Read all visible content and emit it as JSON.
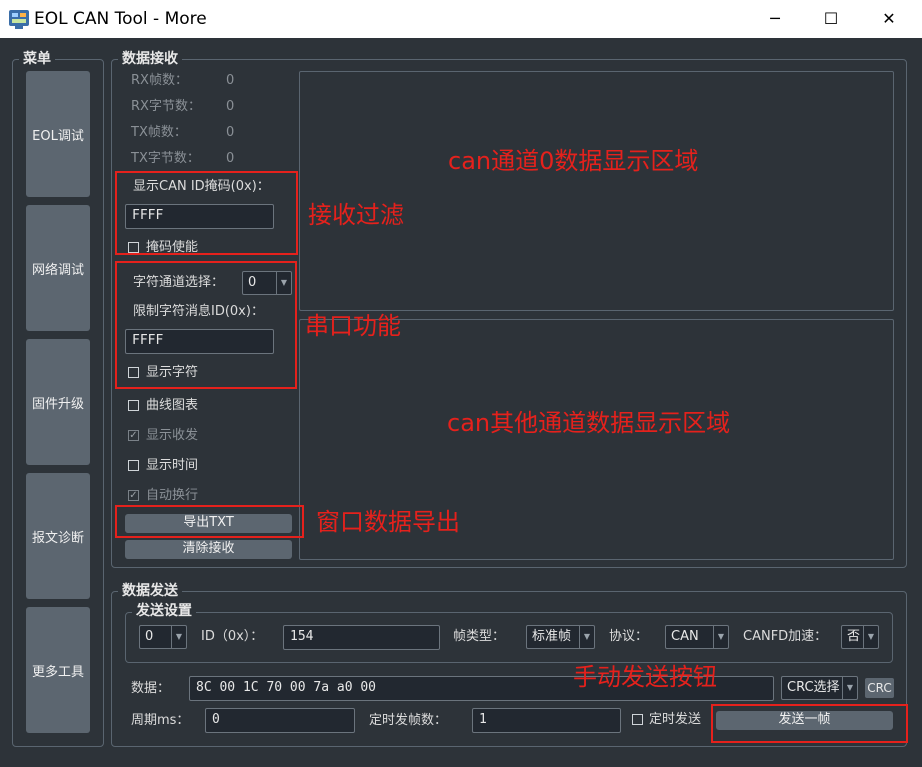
{
  "window": {
    "title": "EOL CAN Tool - More",
    "minimize_glyph": "─",
    "maximize_glyph": "☐",
    "close_glyph": "✕"
  },
  "sidebar": {
    "title": "菜单",
    "items": [
      {
        "label": "EOL调试"
      },
      {
        "label": "网络调试"
      },
      {
        "label": "固件升级"
      },
      {
        "label": "报文诊断"
      },
      {
        "label": "更多工具"
      }
    ]
  },
  "receive": {
    "title": "数据接收",
    "stats": [
      {
        "label": "RX帧数：",
        "value": "0"
      },
      {
        "label": "RX字节数：",
        "value": "0"
      },
      {
        "label": "TX帧数：",
        "value": "0"
      },
      {
        "label": "TX字节数：",
        "value": "0"
      }
    ],
    "mask_label": "显示CAN ID掩码(0x)：",
    "mask_value": "FFFF",
    "mask_enable_label": "掩码使能",
    "char_channel_label": "字符通道选择：",
    "char_channel_value": "0",
    "char_id_label": "限制字符消息ID(0x)：",
    "char_id_value": "FFFF",
    "show_chars_label": "显示字符",
    "curve_chart_label": "曲线图表",
    "show_txrx_label": "显示收发",
    "show_time_label": "显示时间",
    "auto_wrap_label": "自动换行",
    "checkmark": "✓",
    "export_label": "导出TXT",
    "clear_label": "清除接收"
  },
  "send": {
    "title": "数据发送",
    "settings_title": "发送设置",
    "channel_value": "0",
    "id_label": "ID（0x）：",
    "id_value": "154",
    "frame_type_label": "帧类型：",
    "frame_type_value": "标准帧",
    "protocol_label": "协议：",
    "protocol_value": "CAN",
    "canfd_label": "CANFD加速：",
    "canfd_value": "否",
    "data_label": "数据：",
    "data_value": "8C 00 1C 70 00 7a a0 00",
    "crc_select_value": "CRC选择",
    "crc_tag": "CRC",
    "period_label": "周期ms：",
    "period_value": "0",
    "timed_count_label": "定时发帧数：",
    "timed_count_value": "1",
    "timed_send_label": "定时发送",
    "send_one_label": "发送一帧"
  },
  "annotations": {
    "can0_area": "can通道0数据显示区域",
    "filter": "接收过滤",
    "serial": "串口功能",
    "other_channels_area": "can其他通道数据显示区域",
    "export": "窗口数据导出",
    "manual_send": "手动发送按钮"
  },
  "colors": {
    "annotation_red": "#e5211c",
    "background": "#2d3339",
    "button": "#5c6670"
  }
}
